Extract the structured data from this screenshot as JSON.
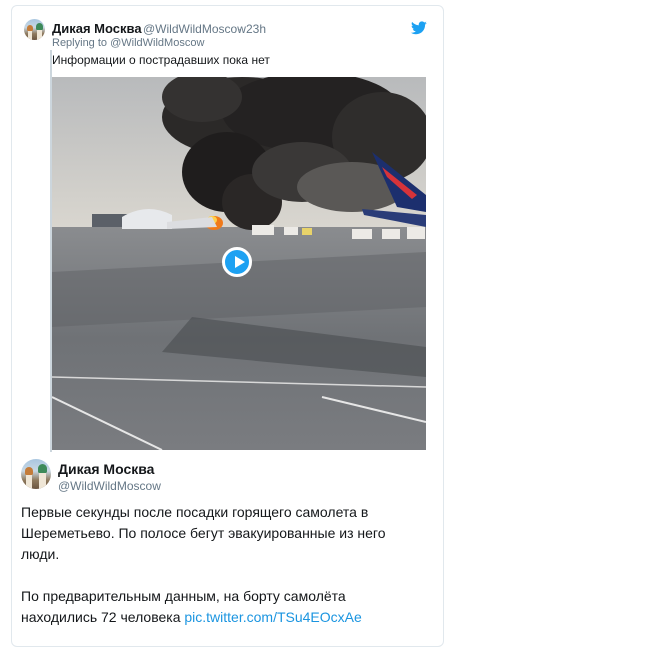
{
  "tweet": {
    "author_name": "Дикая Москва",
    "author_handle": "@WildWildMoscow",
    "time": "23h",
    "replying_prefix": "Replying to",
    "replying_to": "@WildWildMoscow",
    "text": "Информации о пострадавших пока нет"
  },
  "quoted": {
    "author_name": "Дикая Москва",
    "author_handle": "@WildWildMoscow",
    "paragraph1": "Первые секунды после посадки горящего самолета в Шереметьево. По полосе бегут эвакуированные из него люди.",
    "paragraph2_text": "По предварительным данным, на борту самолёта находились 72 человека",
    "paragraph2_link": "pic.twitter.com/TSu4EOcxAe"
  },
  "icons": {
    "brand": "twitter-bird-icon",
    "media_control": "play-icon"
  },
  "colors": {
    "twitter_blue": "#1da1f2",
    "link": "#1b95e0",
    "muted": "#657786"
  }
}
